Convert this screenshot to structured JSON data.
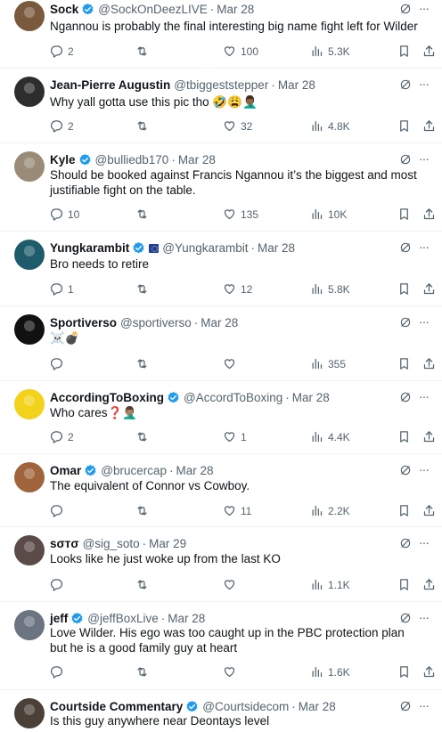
{
  "tweets": [
    {
      "name": "Sock",
      "verified": true,
      "handle": "@SockOnDeezLIVE",
      "date": "Mar 28",
      "text": "Ngannou is probably the final interesting big name fight left for Wilder",
      "replies": "2",
      "retweets": "",
      "likes": "100",
      "views": "5.3K",
      "avatar_color": "#7a5a3c"
    },
    {
      "name": "Jean-Pierre Augustin",
      "verified": false,
      "handle": "@tbiggeststepper",
      "date": "Mar 28",
      "text": "Why yall gotta use this pic tho 🤣😩🤦🏾‍♂️",
      "replies": "2",
      "retweets": "",
      "likes": "32",
      "views": "4.8K",
      "avatar_color": "#2d2d2d"
    },
    {
      "name": "Kyle",
      "verified": true,
      "handle": "@bulliedb170",
      "date": "Mar 28",
      "text": "Should be booked against Francis Ngannou it’s the biggest and most justifiable fight on the table.",
      "replies": "10",
      "retweets": "",
      "likes": "135",
      "views": "10K",
      "avatar_color": "#9a8a78"
    },
    {
      "name": "Yungkarambit",
      "verified": true,
      "handle": "@Yungkarambit",
      "date": "Mar 28",
      "text": "Bro needs to retire",
      "replies": "1",
      "retweets": "",
      "likes": "12",
      "views": "5.8K",
      "avatar_color": "#1f5c6b"
    },
    {
      "name": "Sportiverso",
      "verified": false,
      "handle": "@sportiverso",
      "date": "Mar 28",
      "text": "☠️💣",
      "replies": "",
      "retweets": "",
      "likes": "",
      "views": "355",
      "avatar_color": "#111111"
    },
    {
      "name": "AccordingToBoxing",
      "verified": true,
      "handle": "@AccordToBoxing",
      "date": "Mar 28",
      "text": "Who cares❓🤦🏽‍♂️",
      "replies": "2",
      "retweets": "",
      "likes": "1",
      "views": "4.4K",
      "avatar_color": "#f2d21b"
    },
    {
      "name": "Omar",
      "verified": true,
      "handle": "@brucercap",
      "date": "Mar 28",
      "text": "The equivalent of Connor vs Cowboy.",
      "replies": "",
      "retweets": "",
      "likes": "11",
      "views": "2.2K",
      "avatar_color": "#a0643c"
    },
    {
      "name": "sσтσ",
      "verified": false,
      "handle": "@sig_soto",
      "date": "Mar 29",
      "text": "Looks like he just woke up from the last KO",
      "replies": "",
      "retweets": "",
      "likes": "",
      "views": "1.1K",
      "avatar_color": "#5a4a48"
    },
    {
      "name": "jeff",
      "verified": true,
      "handle": "@jeffBoxLive",
      "date": "Mar 28",
      "text": "Love Wilder. His ego was too caught up in the PBC protection plan but he is a good family guy at heart",
      "replies": "",
      "retweets": "",
      "likes": "",
      "views": "1.6K",
      "avatar_color": "#6b7480"
    },
    {
      "name": "Courtside Commentary",
      "verified": true,
      "handle": "@Courtsidecom",
      "date": "Mar 28",
      "text": "Is this guy anywhere near Deontays level",
      "replies": "",
      "retweets": "",
      "likes": "",
      "views": "",
      "avatar_color": "#4a4038"
    }
  ],
  "colors": {
    "verified": "#1d9bf0",
    "secondary_text": "#536471",
    "divider": "#eff3f4"
  },
  "icons": [
    "verified-badge-icon",
    "grok-icon",
    "more-icon",
    "reply-icon",
    "retweet-icon",
    "like-icon",
    "views-icon",
    "bookmark-icon",
    "share-icon"
  ]
}
